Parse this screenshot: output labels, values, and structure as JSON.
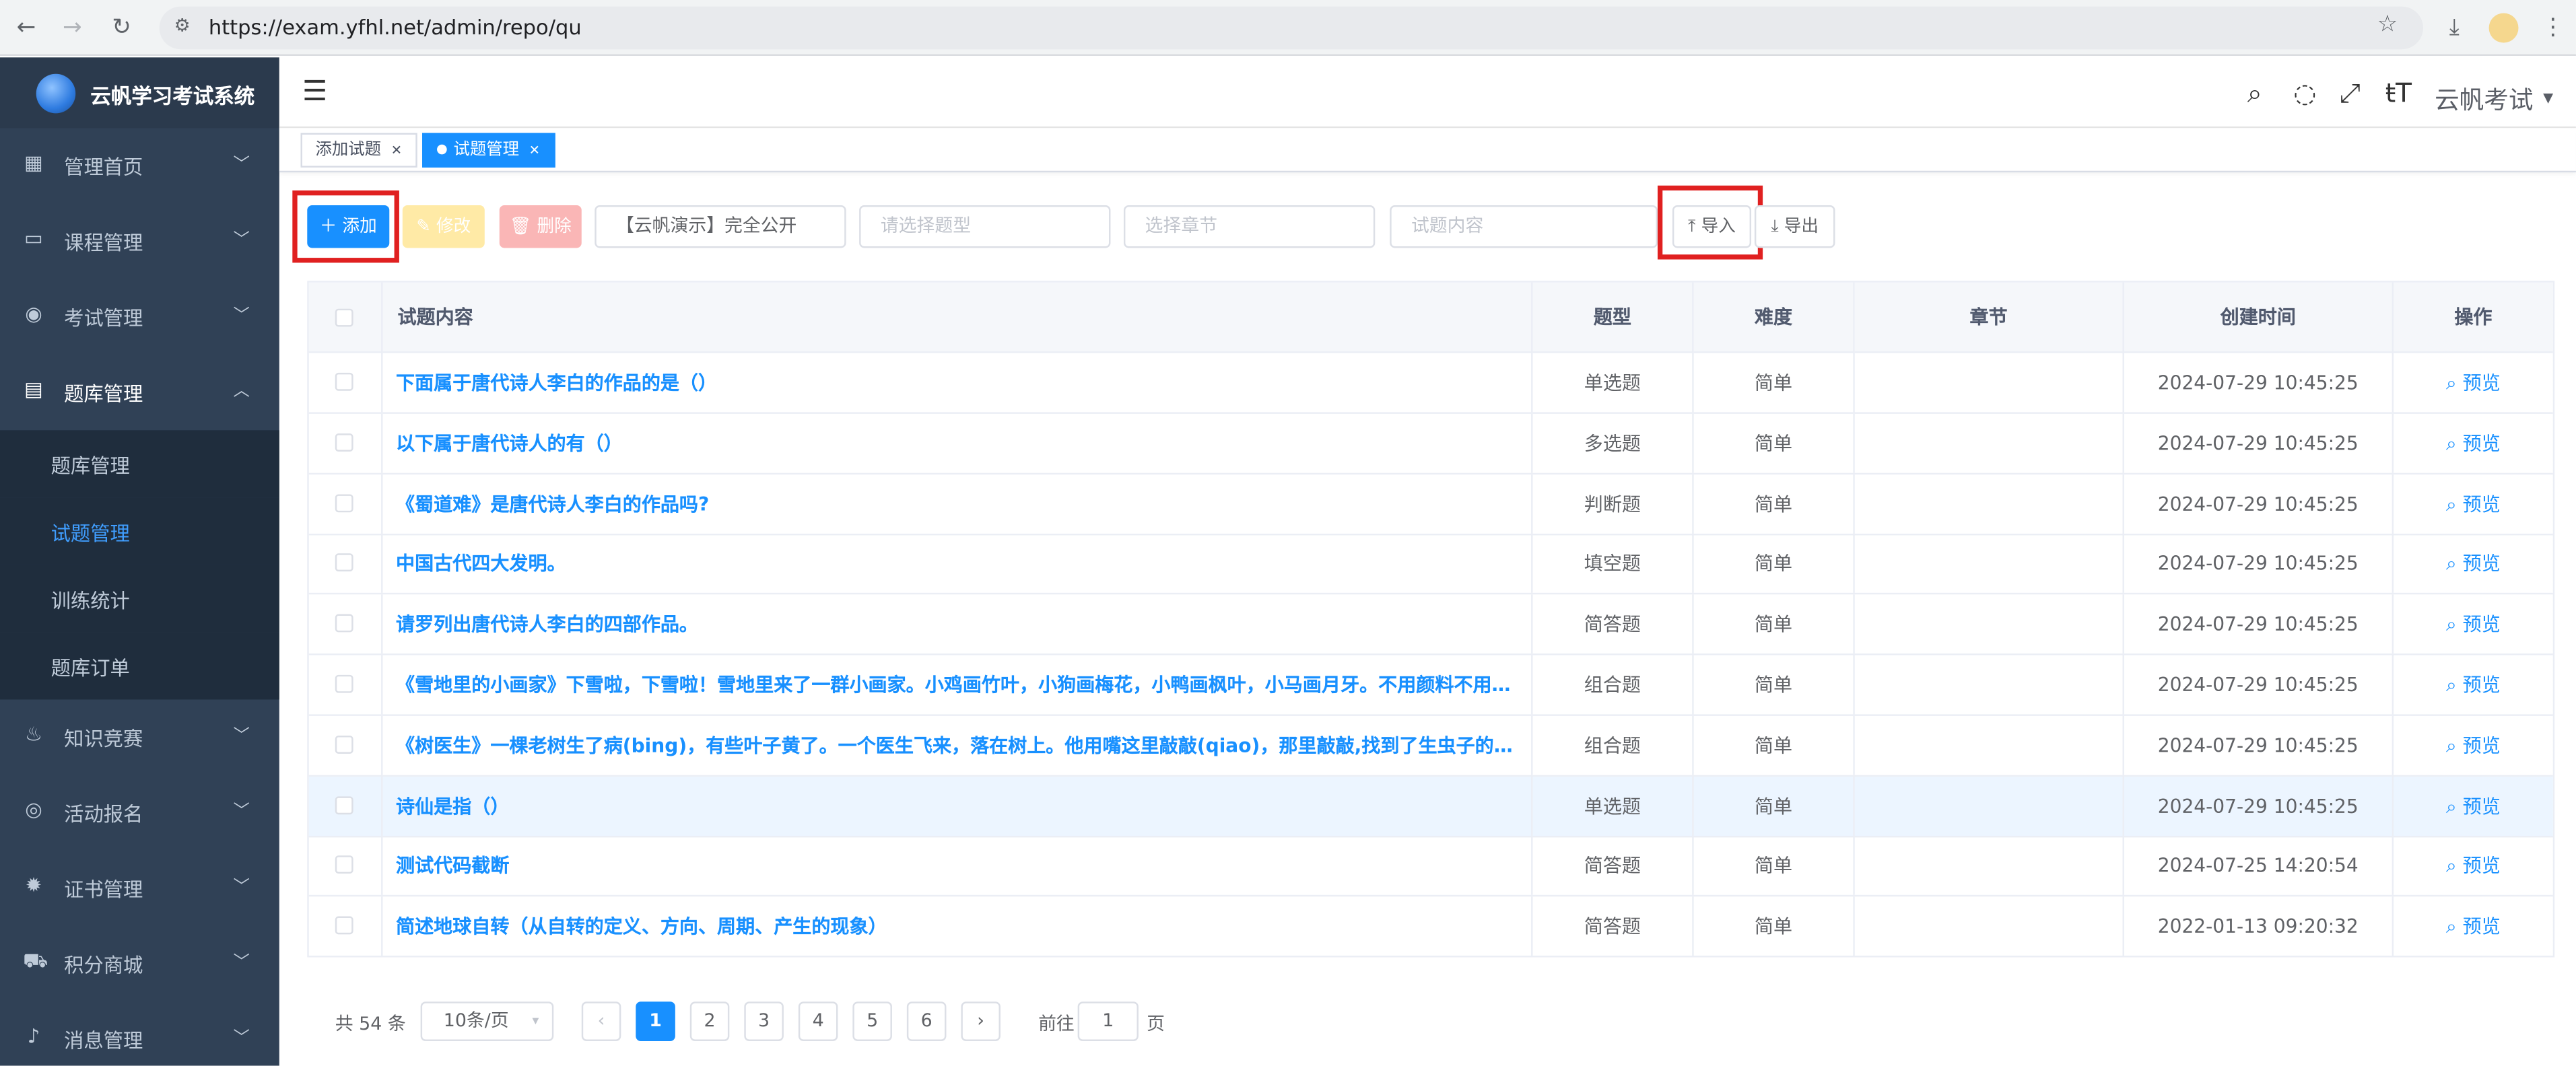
{
  "browser": {
    "url": "https://exam.yfhl.net/admin/repo/qu"
  },
  "sidebar": {
    "logo_text": "云帆学习考试系统",
    "items": [
      {
        "label": "管理首页",
        "icon": "dashboard-icon"
      },
      {
        "label": "课程管理",
        "icon": "monitor-icon"
      },
      {
        "label": "考试管理",
        "icon": "exam-icon"
      },
      {
        "label": "题库管理",
        "icon": "document-icon"
      },
      {
        "label": "知识竞赛",
        "icon": "fire-icon"
      },
      {
        "label": "活动报名",
        "icon": "activity-icon"
      },
      {
        "label": "证书管理",
        "icon": "certificate-icon"
      },
      {
        "label": "积分商城",
        "icon": "cart-icon"
      },
      {
        "label": "消息管理",
        "icon": "bell-icon"
      }
    ],
    "subitems": [
      "题库管理",
      "试题管理",
      "训练统计",
      "题库订单"
    ],
    "active_subitem": "试题管理"
  },
  "header": {
    "username": "云帆考试"
  },
  "tags": [
    {
      "label": "添加试题",
      "active": false
    },
    {
      "label": "试题管理",
      "active": true
    }
  ],
  "toolbar": {
    "add": "添加",
    "edit": "修改",
    "delete": "删除",
    "repo_value": "【云帆演示】完全公开",
    "type_placeholder": "请选择题型",
    "chapter_placeholder": "选择章节",
    "content_placeholder": "试题内容",
    "import": "导入",
    "export": "导出"
  },
  "table": {
    "headers": [
      "试题内容",
      "题型",
      "难度",
      "章节",
      "创建时间",
      "操作"
    ],
    "rows": [
      {
        "content": "下面属于唐代诗人李白的作品的是（）",
        "type": "单选题",
        "level": "简单",
        "chapter": "",
        "time": "2024-07-29 10:45:25",
        "action": "预览"
      },
      {
        "content": "以下属于唐代诗人的有（）",
        "type": "多选题",
        "level": "简单",
        "chapter": "",
        "time": "2024-07-29 10:45:25",
        "action": "预览"
      },
      {
        "content": "《蜀道难》是唐代诗人李白的作品吗?",
        "type": "判断题",
        "level": "简单",
        "chapter": "",
        "time": "2024-07-29 10:45:25",
        "action": "预览"
      },
      {
        "content": "中国古代四大发明。",
        "type": "填空题",
        "level": "简单",
        "chapter": "",
        "time": "2024-07-29 10:45:25",
        "action": "预览"
      },
      {
        "content": "请罗列出唐代诗人李白的四部作品。",
        "type": "简答题",
        "level": "简单",
        "chapter": "",
        "time": "2024-07-29 10:45:25",
        "action": "预览"
      },
      {
        "content": "《雪地里的小画家》下雪啦，下雪啦！雪地里来了一群小画家。小鸡画竹叶，小狗画梅花，小鸭画枫叶，小马画月牙。不用颜料不用…",
        "type": "组合题",
        "level": "简单",
        "chapter": "",
        "time": "2024-07-29 10:45:25",
        "action": "预览"
      },
      {
        "content": "《树医生》一棵老树生了病(bing)，有些叶子黄了。一个医生飞来，落在树上。他用嘴这里敲敲(qiao)，那里敲敲,找到了生虫子的地…",
        "type": "组合题",
        "level": "简单",
        "chapter": "",
        "time": "2024-07-29 10:45:25",
        "action": "预览"
      },
      {
        "content": "诗仙是指（）",
        "type": "单选题",
        "level": "简单",
        "chapter": "",
        "time": "2024-07-29 10:45:25",
        "action": "预览"
      },
      {
        "content": "测试代码截断",
        "type": "简答题",
        "level": "简单",
        "chapter": "",
        "time": "2024-07-25 14:20:54",
        "action": "预览"
      },
      {
        "content": "简述地球自转（从自转的定义、方向、周期、产生的现象）",
        "type": "简答题",
        "level": "简单",
        "chapter": "",
        "time": "2022-01-13 09:20:32",
        "action": "预览"
      }
    ]
  },
  "pager": {
    "total": "共 54 条",
    "page_size": "10条/页",
    "pages": [
      "1",
      "2",
      "3",
      "4",
      "5",
      "6"
    ],
    "current": "1",
    "goto_prefix": "前往",
    "goto_value": "1",
    "goto_suffix": "页"
  }
}
